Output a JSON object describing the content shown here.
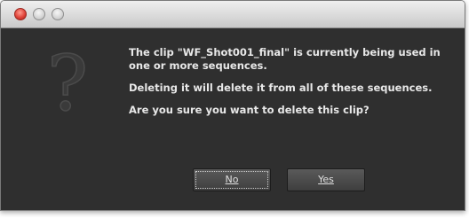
{
  "dialog": {
    "messages": [
      "The clip \"WF_Shot001_final\" is currently being used in one or more sequences.",
      "Deleting it will delete it from all of these sequences.",
      "Are you sure you want to delete this clip?"
    ],
    "icon": "question-mark-icon",
    "icon_glyph": "?"
  },
  "buttons": {
    "no_label": "No",
    "yes_label": "Yes"
  },
  "colors": {
    "background": "#2f2f2f",
    "text": "#e8e8e8",
    "close_button": "#e0443a"
  }
}
